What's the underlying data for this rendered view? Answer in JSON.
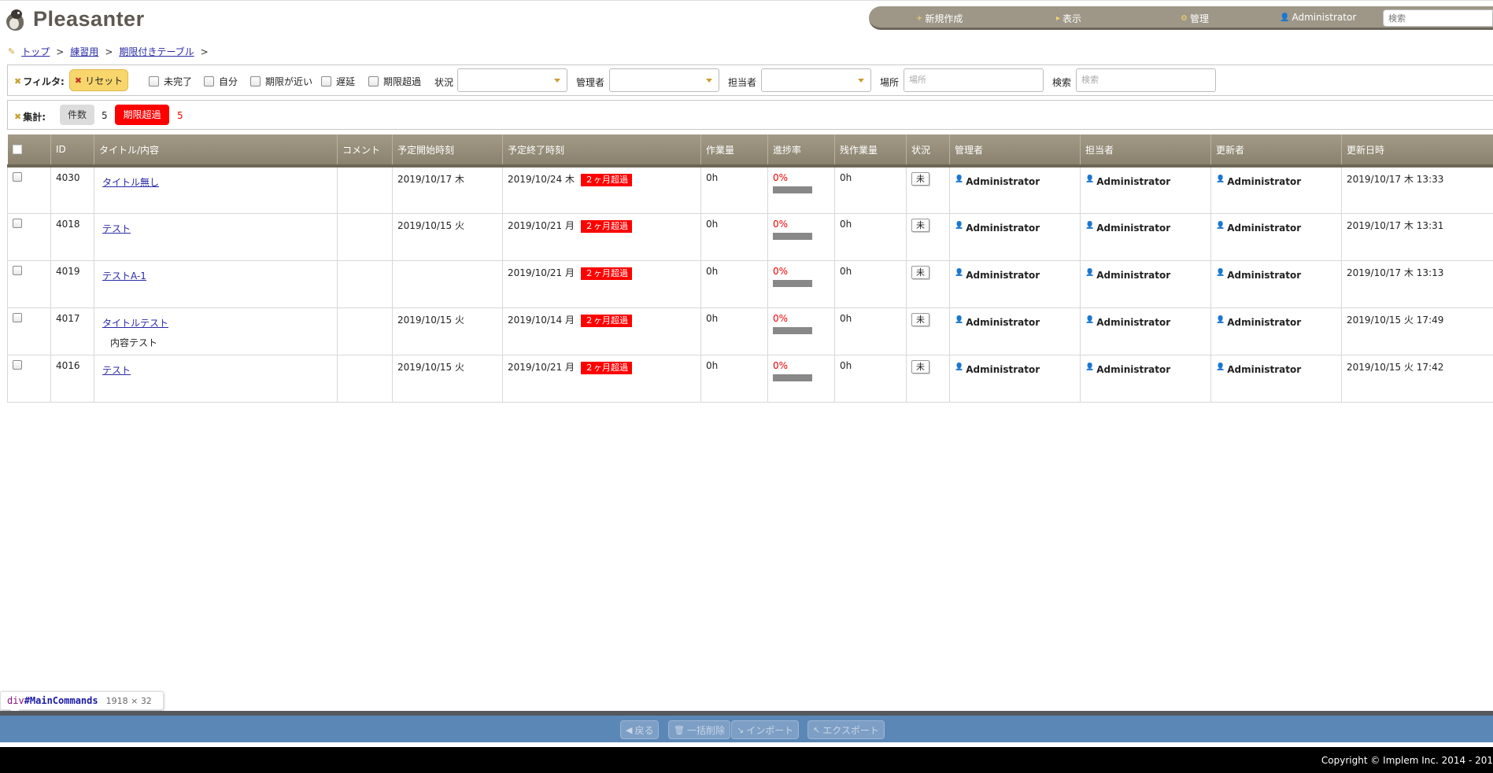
{
  "header": {
    "logo_text": "Pleasanter",
    "nav": [
      {
        "icon": "+",
        "label": "新規作成"
      },
      {
        "icon": "▸",
        "label": "表示"
      },
      {
        "icon": "⚙",
        "label": "管理"
      },
      {
        "icon": "👤",
        "label": "Administrator"
      }
    ],
    "search_placeholder": "検索"
  },
  "breadcrumb": {
    "items": [
      "トップ",
      "練習用",
      "期限付きテーブル"
    ],
    "separator": ">"
  },
  "filter": {
    "label": "フィルタ:",
    "reset_label": "リセット",
    "checkboxes": [
      "未完了",
      "自分",
      "期限が近い",
      "遅延",
      "期限超過"
    ],
    "status_label": "状況",
    "manager_label": "管理者",
    "owner_label": "担当者",
    "location_label": "場所",
    "location_placeholder": "場所",
    "search_label": "検索",
    "search_placeholder": "検索"
  },
  "summary": {
    "label": "集計:",
    "count_label": "件数",
    "count_value": "5",
    "overdue_label": "期限超過",
    "overdue_value": "5"
  },
  "grid": {
    "columns": [
      "ID",
      "タイトル/内容",
      "コメント",
      "予定開始時刻",
      "予定終了時刻",
      "作業量",
      "進捗率",
      "残作業量",
      "状況",
      "管理者",
      "担当者",
      "更新者",
      "更新日時"
    ],
    "rows": [
      {
        "id": "4030",
        "title": "タイトル無し",
        "body": "",
        "comment": "",
        "start": "2019/10/17 木",
        "end": "2019/10/24 木",
        "overdue": "２ヶ月超過",
        "work": "0h",
        "progress": "0%",
        "progress_fraction": 0.0,
        "remaining": "0h",
        "status": "未",
        "manager": "Administrator",
        "owner": "Administrator",
        "updater": "Administrator",
        "updated": "2019/10/17 木 13:33"
      },
      {
        "id": "4018",
        "title": "テスト",
        "body": "",
        "comment": "",
        "start": "2019/10/15 火",
        "end": "2019/10/21 月",
        "overdue": "２ヶ月超過",
        "work": "0h",
        "progress": "0%",
        "progress_fraction": 0.0,
        "remaining": "0h",
        "status": "未",
        "manager": "Administrator",
        "owner": "Administrator",
        "updater": "Administrator",
        "updated": "2019/10/17 木 13:31"
      },
      {
        "id": "4019",
        "title": "テストA-1",
        "body": "",
        "comment": "",
        "start": "",
        "end": "2019/10/21 月",
        "overdue": "２ヶ月超過",
        "work": "0h",
        "progress": "0%",
        "progress_fraction": 0.0,
        "remaining": "0h",
        "status": "未",
        "manager": "Administrator",
        "owner": "Administrator",
        "updater": "Administrator",
        "updated": "2019/10/17 木 13:13"
      },
      {
        "id": "4017",
        "title": "タイトルテスト",
        "body": "内容テスト",
        "comment": "",
        "start": "2019/10/15 火",
        "end": "2019/10/14 月",
        "overdue": "２ヶ月超過",
        "work": "0h",
        "progress": "0%",
        "progress_fraction": 0.0,
        "remaining": "0h",
        "status": "未",
        "manager": "Administrator",
        "owner": "Administrator",
        "updater": "Administrator",
        "updated": "2019/10/15 火 17:49"
      },
      {
        "id": "4016",
        "title": "テスト",
        "body": "",
        "comment": "",
        "start": "2019/10/15 火",
        "end": "2019/10/21 月",
        "overdue": "２ヶ月超過",
        "work": "0h",
        "progress": "0%",
        "progress_fraction": 0.0,
        "remaining": "0h",
        "status": "未",
        "manager": "Administrator",
        "owner": "Administrator",
        "updater": "Administrator",
        "updated": "2019/10/15 火 17:42"
      }
    ]
  },
  "devtools_tooltip": {
    "tag": "div",
    "id": "#MainCommands",
    "dimensions": "1918 × 32"
  },
  "commands": [
    {
      "icon": "◀",
      "label": "戻る"
    },
    {
      "icon": "🗑",
      "label": "一括削除"
    },
    {
      "icon": "↘",
      "label": "インポート"
    },
    {
      "icon": "↖",
      "label": "エクスポート"
    }
  ],
  "footer": {
    "copyright": "Copyright © Implem Inc. 2014 - 201"
  },
  "colors": {
    "header_bar": "#9e9788",
    "grid_header": "#8a826f",
    "overdue_red": "#ff0000",
    "command_bar": "#5a87b6",
    "reset_yellow": "#f8d66c"
  }
}
